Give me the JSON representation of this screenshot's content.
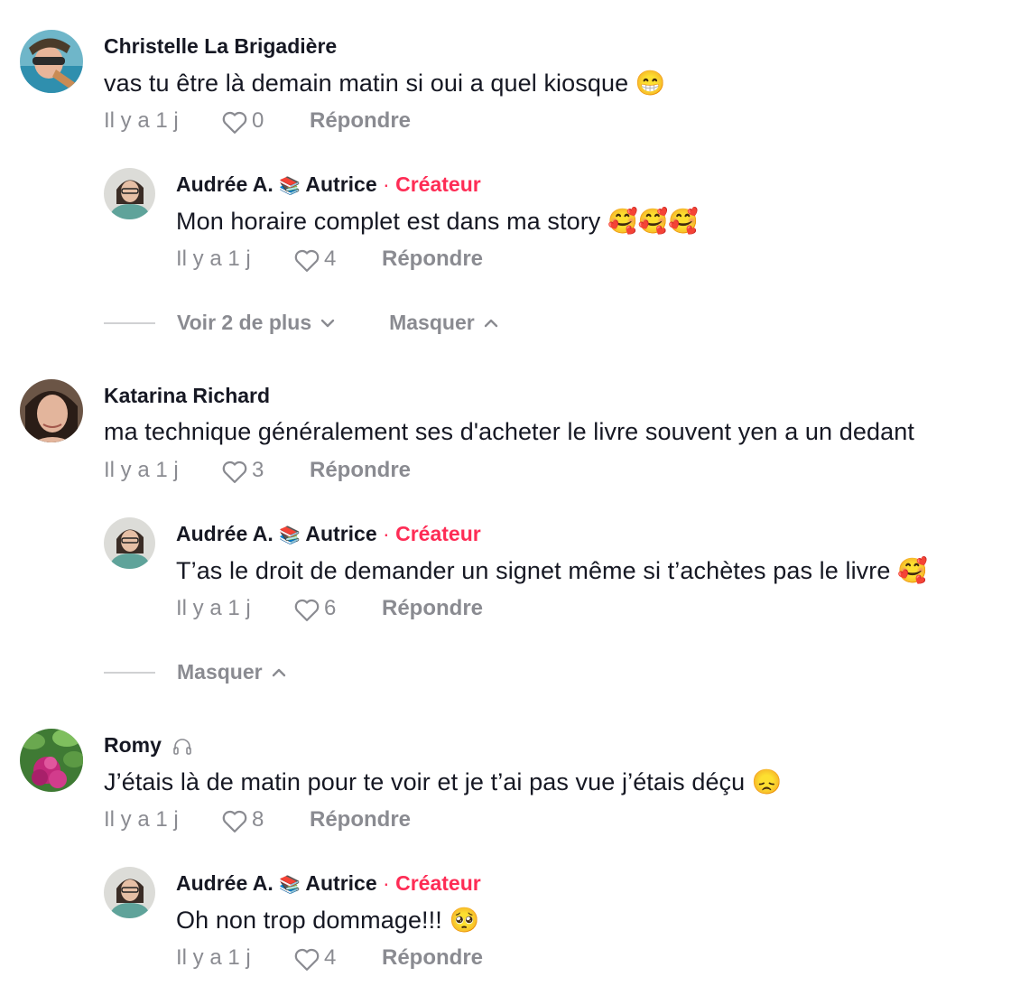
{
  "comments": [
    {
      "author": "Christelle La Brigadière",
      "text": "vas tu être là demain matin si oui a quel kiosque 😁",
      "time": "Il y a 1 j",
      "likes": "0",
      "reply": "Répondre",
      "reply_comment": {
        "author": "Audrée A.",
        "books_emoji": "📚",
        "author_suffix": "Autrice",
        "creator_badge": "Créateur",
        "text": "Mon horaire complet est dans ma story 🥰🥰🥰",
        "time": "Il y a 1 j",
        "likes": "4",
        "reply": "Répondre"
      },
      "expander": {
        "more": "Voir 2 de plus",
        "hide": "Masquer"
      }
    },
    {
      "author": "Katarina Richard",
      "text": "ma technique généralement ses d'acheter le livre souvent yen a un dedant",
      "time": "Il y a 1 j",
      "likes": "3",
      "reply": "Répondre",
      "reply_comment": {
        "author": "Audrée A.",
        "books_emoji": "📚",
        "author_suffix": "Autrice",
        "creator_badge": "Créateur",
        "text": "T’as le droit de demander un signet même si t’achètes pas le livre 🥰",
        "time": "Il y a 1 j",
        "likes": "6",
        "reply": "Répondre"
      },
      "expander": {
        "hide": "Masquer"
      }
    },
    {
      "author": "Romy",
      "text": "J’étais là de matin pour te voir et je t’ai pas vue j’étais déçu 😞",
      "time": "Il y a 1 j",
      "likes": "8",
      "reply": "Répondre",
      "reply_comment": {
        "author": "Audrée A.",
        "books_emoji": "📚",
        "author_suffix": "Autrice",
        "creator_badge": "Créateur",
        "text": "Oh non trop dommage!!! 🥺",
        "time": "Il y a 1 j",
        "likes": "4",
        "reply": "Répondre"
      }
    }
  ],
  "colors": {
    "creator": "#fe2c55",
    "muted": "#8a8b91",
    "text": "#161823"
  }
}
